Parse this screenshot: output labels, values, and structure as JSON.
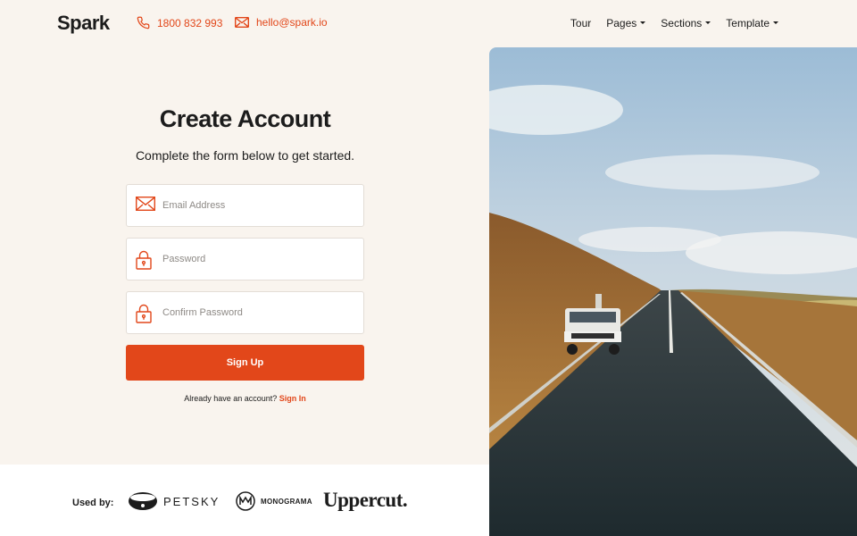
{
  "header": {
    "logo": "Spark",
    "phone": "1800 832 993",
    "email": "hello@spark.io",
    "nav": [
      {
        "label": "Tour",
        "dropdown": false
      },
      {
        "label": "Pages",
        "dropdown": true
      },
      {
        "label": "Sections",
        "dropdown": true
      },
      {
        "label": "Template",
        "dropdown": true
      }
    ]
  },
  "form": {
    "title": "Create Account",
    "subtitle": "Complete the form below to get started.",
    "email_placeholder": "Email Address",
    "password_placeholder": "Password",
    "confirm_placeholder": "Confirm Password",
    "submit_label": "Sign Up",
    "signin_prompt": "Already have an account?",
    "signin_link": "Sign In"
  },
  "footer": {
    "used_by_label": "Used by:",
    "brands": [
      "PETSKY",
      "MONOGRAMA",
      "Uppercut."
    ]
  },
  "colors": {
    "accent": "#e2471a",
    "background": "#f9f4ee"
  },
  "icons": {
    "phone": "phone-icon",
    "mail": "mail-icon",
    "lock": "lock-icon"
  }
}
